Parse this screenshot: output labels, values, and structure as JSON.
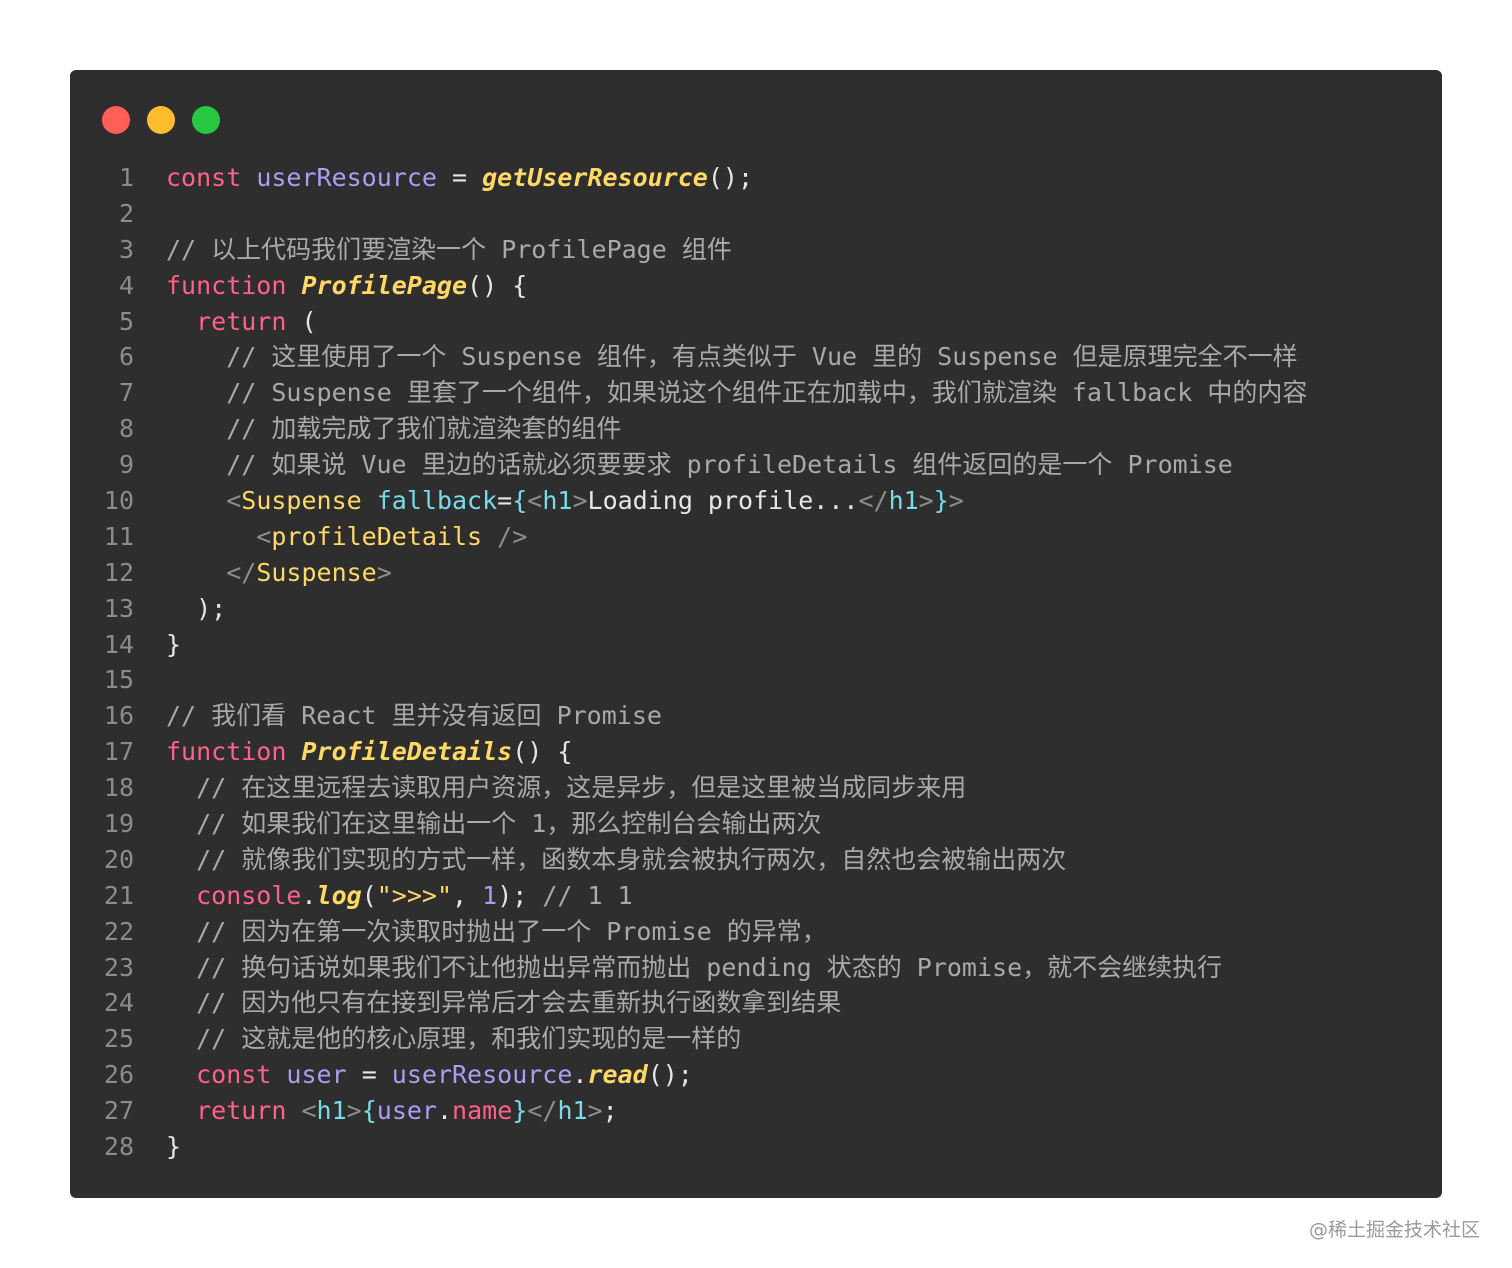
{
  "colors": {
    "keyword": "#ff6188",
    "variable": "#ab9df2",
    "function": "#ffd866",
    "comment": "#a9a9a9",
    "punct": "#e6e6e6",
    "tag_bracket": "#8e8e8e",
    "tag_name": "#ffd866",
    "attr": "#78dce8",
    "string": "#ffd866",
    "number": "#ab9df2",
    "brace": "#78dce8",
    "text": "#e6e6e6"
  },
  "window": {
    "traffic_lights": [
      {
        "name": "close-light",
        "color": "#ff5f57"
      },
      {
        "name": "minimize-light",
        "color": "#febc2e"
      },
      {
        "name": "zoom-light",
        "color": "#28c840"
      }
    ]
  },
  "code_lines": [
    {
      "n": "1",
      "tokens": [
        [
          "const ",
          "keyword"
        ],
        [
          "userResource ",
          "variable"
        ],
        [
          "= ",
          "punct"
        ],
        [
          "getUserResource",
          "function",
          "i"
        ],
        [
          "();",
          "punct"
        ]
      ]
    },
    {
      "n": "2",
      "tokens": []
    },
    {
      "n": "3",
      "tokens": [
        [
          "// 以上代码我们要渲染一个 ProfilePage 组件",
          "comment"
        ]
      ]
    },
    {
      "n": "4",
      "tokens": [
        [
          "function ",
          "keyword"
        ],
        [
          "ProfilePage",
          "function",
          "i"
        ],
        [
          "() {",
          "punct"
        ]
      ]
    },
    {
      "n": "5",
      "tokens": [
        [
          "  return ",
          "keyword"
        ],
        [
          "(",
          "punct"
        ]
      ]
    },
    {
      "n": "6",
      "tokens": [
        [
          "    // 这里使用了一个 Suspense 组件，有点类似于 Vue 里的 Suspense 但是原理完全不一样",
          "comment"
        ]
      ]
    },
    {
      "n": "7",
      "tokens": [
        [
          "    // Suspense 里套了一个组件，如果说这个组件正在加载中，我们就渲染 fallback 中的内容",
          "comment"
        ]
      ]
    },
    {
      "n": "8",
      "tokens": [
        [
          "    // 加载完成了我们就渲染套的组件",
          "comment"
        ]
      ]
    },
    {
      "n": "9",
      "tokens": [
        [
          "    // 如果说 Vue 里边的话就必须要要求 profileDetails 组件返回的是一个 Promise",
          "comment"
        ]
      ]
    },
    {
      "n": "10",
      "tokens": [
        [
          "    <",
          "tag_bracket"
        ],
        [
          "Suspense ",
          "tag_name"
        ],
        [
          "fallback",
          "attr"
        ],
        [
          "=",
          "punct"
        ],
        [
          "{",
          "brace"
        ],
        [
          "<",
          "tag_bracket"
        ],
        [
          "h1",
          "attr"
        ],
        [
          ">",
          "tag_bracket"
        ],
        [
          "Loading profile...",
          "text"
        ],
        [
          "</",
          "tag_bracket"
        ],
        [
          "h1",
          "attr"
        ],
        [
          ">",
          "tag_bracket"
        ],
        [
          "}",
          "brace"
        ],
        [
          ">",
          "tag_bracket"
        ]
      ]
    },
    {
      "n": "11",
      "tokens": [
        [
          "      <",
          "tag_bracket"
        ],
        [
          "profileDetails ",
          "tag_name"
        ],
        [
          "/>",
          "tag_bracket"
        ]
      ]
    },
    {
      "n": "12",
      "tokens": [
        [
          "    </",
          "tag_bracket"
        ],
        [
          "Suspense",
          "tag_name"
        ],
        [
          ">",
          "tag_bracket"
        ]
      ]
    },
    {
      "n": "13",
      "tokens": [
        [
          "  );",
          "punct"
        ]
      ]
    },
    {
      "n": "14",
      "tokens": [
        [
          "}",
          "punct"
        ]
      ]
    },
    {
      "n": "15",
      "tokens": []
    },
    {
      "n": "16",
      "tokens": [
        [
          "// 我们看 React 里并没有返回 Promise",
          "comment"
        ]
      ]
    },
    {
      "n": "17",
      "tokens": [
        [
          "function ",
          "keyword"
        ],
        [
          "ProfileDetails",
          "function",
          "i"
        ],
        [
          "() {",
          "punct"
        ]
      ]
    },
    {
      "n": "18",
      "tokens": [
        [
          "  // 在这里远程去读取用户资源，这是异步，但是这里被当成同步来用",
          "comment"
        ]
      ]
    },
    {
      "n": "19",
      "tokens": [
        [
          "  // 如果我们在这里输出一个 1，那么控制台会输出两次",
          "comment"
        ]
      ]
    },
    {
      "n": "20",
      "tokens": [
        [
          "  // 就像我们实现的方式一样，函数本身就会被执行两次，自然也会被输出两次",
          "comment"
        ]
      ]
    },
    {
      "n": "21",
      "tokens": [
        [
          "  console",
          "keyword"
        ],
        [
          ".",
          "punct"
        ],
        [
          "log",
          "function",
          "i"
        ],
        [
          "(",
          "punct"
        ],
        [
          "\">>>\"",
          "string"
        ],
        [
          ", ",
          "punct"
        ],
        [
          "1",
          "number"
        ],
        [
          "); ",
          "punct"
        ],
        [
          "// 1 1",
          "comment"
        ]
      ]
    },
    {
      "n": "22",
      "tokens": [
        [
          "  // 因为在第一次读取时抛出了一个 Promise 的异常，",
          "comment"
        ]
      ]
    },
    {
      "n": "23",
      "tokens": [
        [
          "  // 换句话说如果我们不让他抛出异常而抛出 pending 状态的 Promise，就不会继续执行",
          "comment"
        ]
      ]
    },
    {
      "n": "24",
      "tokens": [
        [
          "  // 因为他只有在接到异常后才会去重新执行函数拿到结果",
          "comment"
        ]
      ]
    },
    {
      "n": "25",
      "tokens": [
        [
          "  // 这就是他的核心原理，和我们实现的是一样的",
          "comment"
        ]
      ]
    },
    {
      "n": "26",
      "tokens": [
        [
          "  const ",
          "keyword"
        ],
        [
          "user ",
          "variable"
        ],
        [
          "= ",
          "punct"
        ],
        [
          "userResource",
          "variable"
        ],
        [
          ".",
          "punct"
        ],
        [
          "read",
          "function",
          "i"
        ],
        [
          "();",
          "punct"
        ]
      ]
    },
    {
      "n": "27",
      "tokens": [
        [
          "  return ",
          "keyword"
        ],
        [
          "<",
          "tag_bracket"
        ],
        [
          "h1",
          "attr"
        ],
        [
          ">",
          "tag_bracket"
        ],
        [
          "{",
          "brace"
        ],
        [
          "user",
          "variable"
        ],
        [
          ".",
          "punct"
        ],
        [
          "name",
          "keyword"
        ],
        [
          "}",
          "brace"
        ],
        [
          "</",
          "tag_bracket"
        ],
        [
          "h1",
          "attr"
        ],
        [
          ">",
          "tag_bracket"
        ],
        [
          ";",
          "punct"
        ]
      ]
    },
    {
      "n": "28",
      "tokens": [
        [
          "}",
          "punct"
        ]
      ]
    }
  ],
  "watermark": "@稀土掘金技术社区"
}
